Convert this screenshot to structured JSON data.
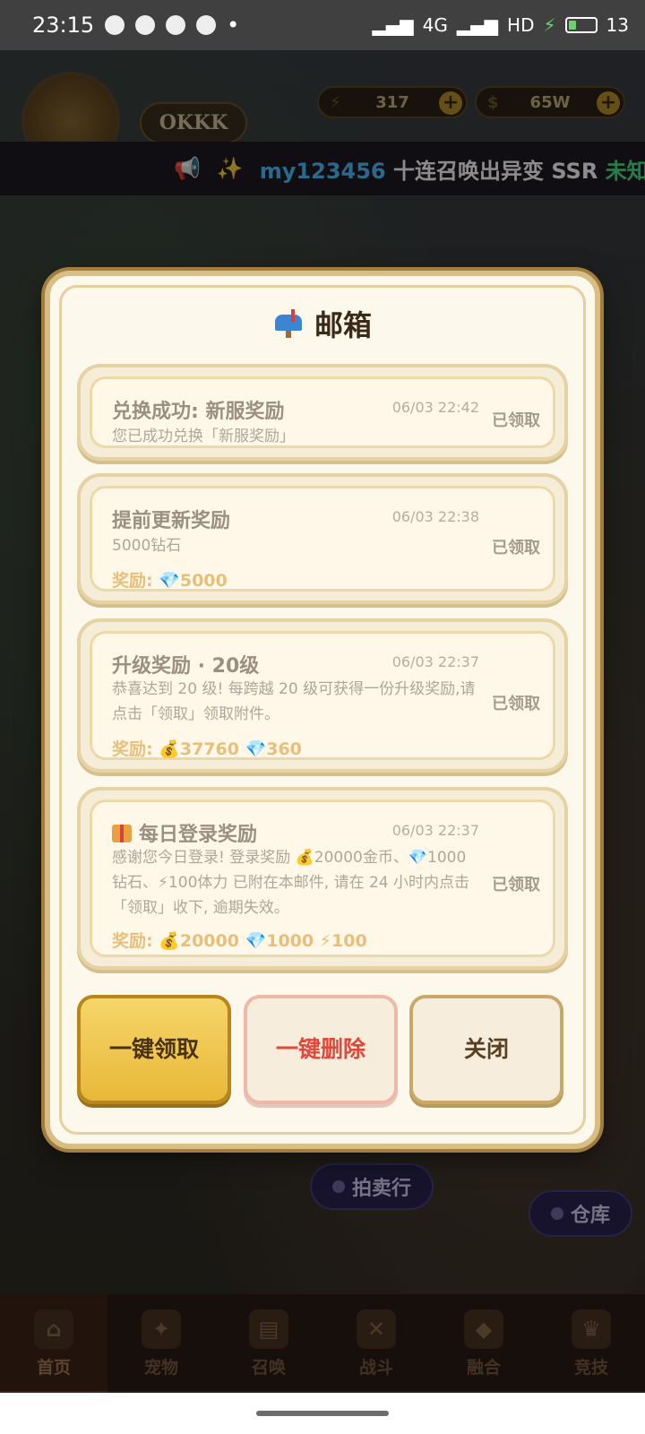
{
  "status_bar": {
    "time": "23:15",
    "network": "4G",
    "hd_label": "HD",
    "battery": "13"
  },
  "game": {
    "player_name": "OKKK",
    "energy": "317",
    "gold": "65W",
    "marquee": {
      "user": "my123456",
      "text": "十连召唤出异变 SSR",
      "highlight": "未知"
    },
    "auction_button": "拍卖行",
    "warehouse_button": "仓库"
  },
  "bottom_nav": [
    {
      "label": "首页",
      "icon": "home-icon",
      "active": true
    },
    {
      "label": "宠物",
      "icon": "paw-icon",
      "active": false
    },
    {
      "label": "召唤",
      "icon": "scroll-icon",
      "active": false
    },
    {
      "label": "战斗",
      "icon": "swords-icon",
      "active": false
    },
    {
      "label": "融合",
      "icon": "dragon-icon",
      "active": false
    },
    {
      "label": "竞技",
      "icon": "trophy-icon",
      "active": false
    }
  ],
  "mailbox": {
    "title": "邮箱",
    "mails": [
      {
        "title": "兑换成功: 新服奖励",
        "time": "06/03 22:42",
        "body": "您已成功兑换「新服奖励」",
        "reward": "",
        "status": "已领取"
      },
      {
        "title": "提前更新奖励",
        "time": "06/03 22:38",
        "body": "5000钻石",
        "reward": "奖励: 💎5000",
        "status": "已领取"
      },
      {
        "title": "升级奖励 · 20级",
        "time": "06/03 22:37",
        "body": "恭喜达到 20 级! 每跨越 20 级可获得一份升级奖励,请点击「领取」领取附件。",
        "reward": "奖励: 💰37760 💎360",
        "status": "已领取"
      },
      {
        "title": "每日登录奖励",
        "time": "06/03 22:37",
        "body": "感谢您今日登录! 登录奖励 💰20000金币、💎1000钻石、⚡100体力 已附在本邮件, 请在 24 小时内点击「领取」收下, 逾期失效。",
        "reward": "奖励: 💰20000 💎1000 ⚡100",
        "status": "已领取"
      }
    ],
    "buttons": {
      "claim_all": "一键领取",
      "delete_all": "一键删除",
      "close": "关闭"
    }
  },
  "colors": {
    "dialog_bg": "#fdf8ec",
    "claim_button": "#f6d56a",
    "delete_text": "#e2473c",
    "reward_text": "#e8bf7a",
    "marquee_user": "#4fc0ff",
    "marquee_highlight": "#4ee08a"
  }
}
